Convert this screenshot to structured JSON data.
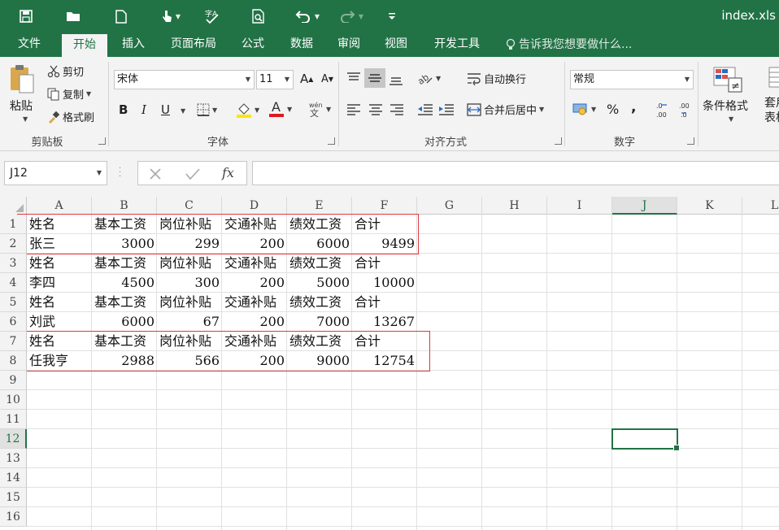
{
  "window": {
    "title": "index.xls"
  },
  "tabs": [
    "文件",
    "开始",
    "插入",
    "页面布局",
    "公式",
    "数据",
    "审阅",
    "视图",
    "开发工具"
  ],
  "active_tab": "开始",
  "tell_me": "告诉我您想要做什么...",
  "clipboard": {
    "paste": "粘贴",
    "cut": "剪切",
    "copy": "复制",
    "format_painter": "格式刷",
    "group": "剪贴板"
  },
  "font": {
    "name": "宋体",
    "size": "11",
    "group": "字体",
    "bold": "B",
    "italic": "I",
    "underline": "U"
  },
  "alignment": {
    "wrap": "自动换行",
    "merge": "合并后居中",
    "group": "对齐方式"
  },
  "number": {
    "format": "常规",
    "group": "数字",
    "percent": "%",
    "comma": ","
  },
  "styles": {
    "conditional": "条件格式",
    "table": "套用表格"
  },
  "formula_bar": {
    "name_box": "J12",
    "fx": "fx",
    "value": ""
  },
  "columns": [
    "A",
    "B",
    "C",
    "D",
    "E",
    "F",
    "G",
    "H",
    "I",
    "J",
    "K",
    "L"
  ],
  "selected_column": "J",
  "selected_row": "12",
  "rows": [
    "1",
    "2",
    "3",
    "4",
    "5",
    "6",
    "7",
    "8",
    "9",
    "10",
    "11",
    "12",
    "13",
    "14",
    "15",
    "16"
  ],
  "cells": [
    {
      "ref": "A1",
      "v": "姓名"
    },
    {
      "ref": "B1",
      "v": "基本工资"
    },
    {
      "ref": "C1",
      "v": "岗位补贴"
    },
    {
      "ref": "D1",
      "v": "交通补贴"
    },
    {
      "ref": "E1",
      "v": "绩效工资"
    },
    {
      "ref": "F1",
      "v": "合计"
    },
    {
      "ref": "A2",
      "v": "张三"
    },
    {
      "ref": "B2",
      "v": "3000",
      "num": true
    },
    {
      "ref": "C2",
      "v": "299",
      "num": true
    },
    {
      "ref": "D2",
      "v": "200",
      "num": true
    },
    {
      "ref": "E2",
      "v": "6000",
      "num": true
    },
    {
      "ref": "F2",
      "v": "9499",
      "num": true
    },
    {
      "ref": "A3",
      "v": "姓名"
    },
    {
      "ref": "B3",
      "v": "基本工资"
    },
    {
      "ref": "C3",
      "v": "岗位补贴"
    },
    {
      "ref": "D3",
      "v": "交通补贴"
    },
    {
      "ref": "E3",
      "v": "绩效工资"
    },
    {
      "ref": "F3",
      "v": "合计"
    },
    {
      "ref": "A4",
      "v": "李四"
    },
    {
      "ref": "B4",
      "v": "4500",
      "num": true
    },
    {
      "ref": "C4",
      "v": "300",
      "num": true
    },
    {
      "ref": "D4",
      "v": "200",
      "num": true
    },
    {
      "ref": "E4",
      "v": "5000",
      "num": true
    },
    {
      "ref": "F4",
      "v": "10000",
      "num": true
    },
    {
      "ref": "A5",
      "v": "姓名"
    },
    {
      "ref": "B5",
      "v": "基本工资"
    },
    {
      "ref": "C5",
      "v": "岗位补贴"
    },
    {
      "ref": "D5",
      "v": "交通补贴"
    },
    {
      "ref": "E5",
      "v": "绩效工资"
    },
    {
      "ref": "F5",
      "v": "合计"
    },
    {
      "ref": "A6",
      "v": "刘武"
    },
    {
      "ref": "B6",
      "v": "6000",
      "num": true
    },
    {
      "ref": "C6",
      "v": "67",
      "num": true
    },
    {
      "ref": "D6",
      "v": "200",
      "num": true
    },
    {
      "ref": "E6",
      "v": "7000",
      "num": true
    },
    {
      "ref": "F6",
      "v": "13267",
      "num": true
    },
    {
      "ref": "A7",
      "v": "姓名"
    },
    {
      "ref": "B7",
      "v": "基本工资"
    },
    {
      "ref": "C7",
      "v": "岗位补贴"
    },
    {
      "ref": "D7",
      "v": "交通补贴"
    },
    {
      "ref": "E7",
      "v": "绩效工资"
    },
    {
      "ref": "F7",
      "v": "合计"
    },
    {
      "ref": "A8",
      "v": "任我亨"
    },
    {
      "ref": "B8",
      "v": "2988",
      "num": true
    },
    {
      "ref": "C8",
      "v": "566",
      "num": true
    },
    {
      "ref": "D8",
      "v": "200",
      "num": true
    },
    {
      "ref": "E8",
      "v": "9000",
      "num": true
    },
    {
      "ref": "F8",
      "v": "12754",
      "num": true
    }
  ],
  "highlight_ranges": [
    "A1:F2",
    "A7:F8"
  ],
  "colors": {
    "excel_green": "#217346",
    "highlight": "#e0393e"
  }
}
